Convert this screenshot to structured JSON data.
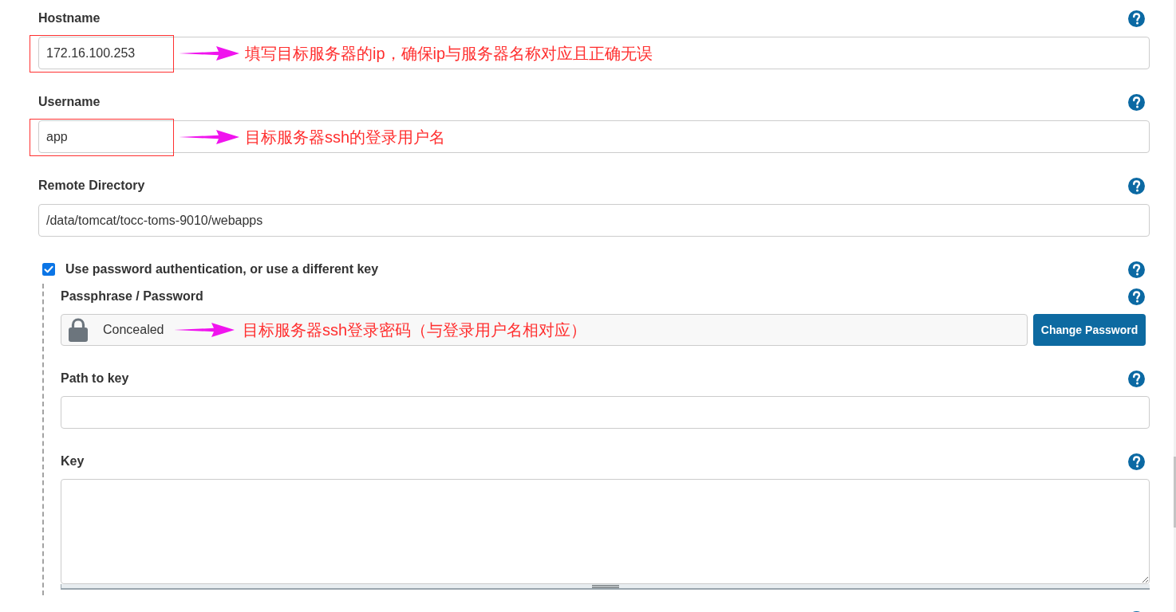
{
  "fields": [
    {
      "kind": "text",
      "label": "Hostname",
      "value": "172.16.100.253",
      "highlighted": true,
      "annotation": "填写目标服务器的ip，确保ip与服务器名称对应且正确无误"
    },
    {
      "kind": "text",
      "label": "Username",
      "value": "app",
      "highlighted": true,
      "annotation": "目标服务器ssh的登录用户名"
    },
    {
      "kind": "text",
      "label": "Remote Directory",
      "value": "/data/tomcat/tocc-toms-9010/webapps",
      "highlighted": false
    },
    {
      "kind": "checkbox",
      "label": "Use password authentication, or use a different key",
      "checked": true,
      "children": [
        {
          "kind": "secret",
          "label": "Passphrase / Password",
          "value": "Concealed",
          "button": "Change Password",
          "annotation": "目标服务器ssh登录密码（与登录用户名相对应）"
        },
        {
          "kind": "text",
          "label": "Path to key",
          "highlighted": false
        },
        {
          "kind": "textarea",
          "label": "Key"
        }
      ]
    }
  ]
}
